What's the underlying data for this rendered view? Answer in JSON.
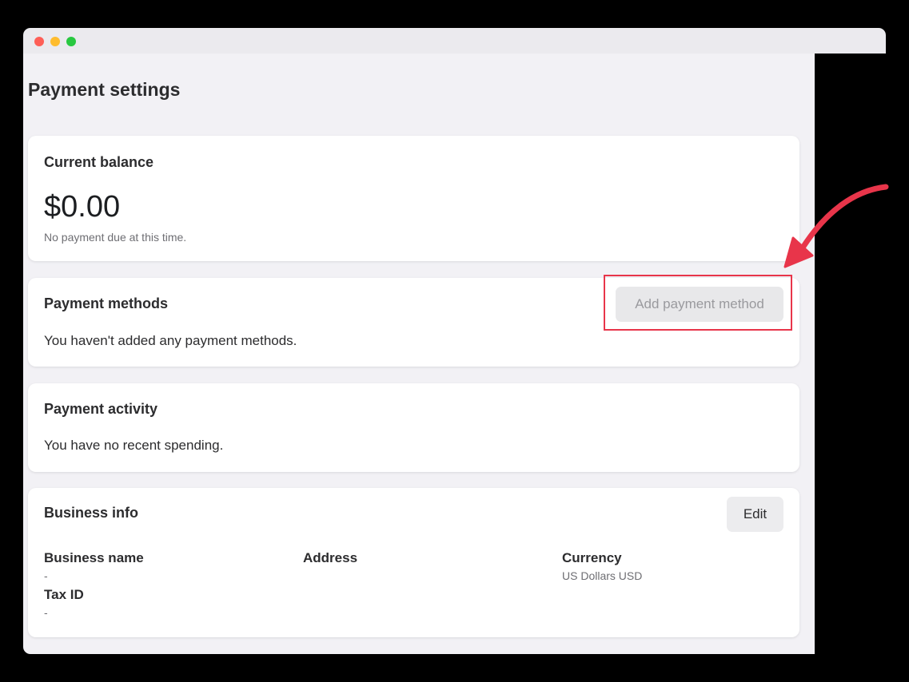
{
  "page": {
    "title": "Payment settings"
  },
  "balance": {
    "title": "Current balance",
    "amount": "$0.00",
    "note": "No payment due at this time."
  },
  "payment_methods": {
    "title": "Payment methods",
    "add_label": "Add payment method",
    "empty_text": "You haven't added any payment methods."
  },
  "payment_activity": {
    "title": "Payment activity",
    "empty_text": "You have no recent spending."
  },
  "business_info": {
    "title": "Business info",
    "edit_label": "Edit",
    "fields": {
      "business_name": {
        "label": "Business name",
        "value": "-"
      },
      "address": {
        "label": "Address",
        "value": ""
      },
      "currency": {
        "label": "Currency",
        "value": "US Dollars USD"
      },
      "tax_id": {
        "label": "Tax ID",
        "value": "-"
      }
    }
  },
  "colors": {
    "annotation": "#e8354a",
    "background": "#f2f1f5",
    "card": "#ffffff"
  }
}
